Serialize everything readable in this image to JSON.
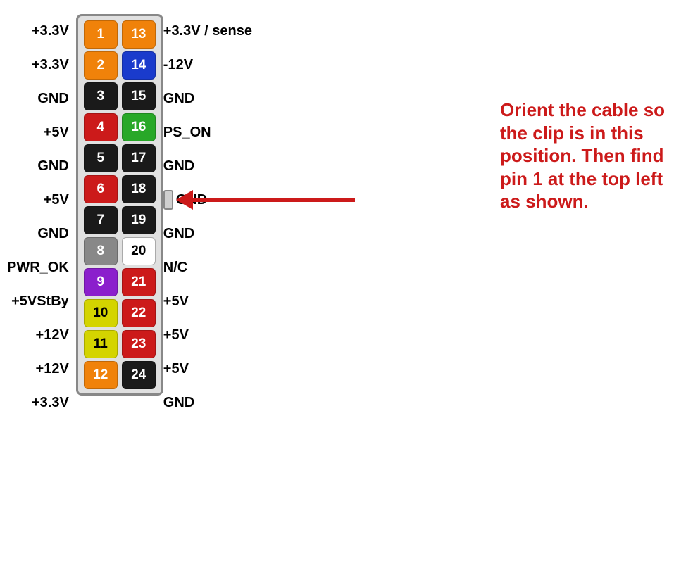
{
  "pins": [
    {
      "left": "+3.3V",
      "num1": "1",
      "color1": "orange",
      "num2": "13",
      "color2": "orange",
      "right": "+3.3V / sense"
    },
    {
      "left": "+3.3V",
      "num1": "2",
      "color1": "orange",
      "num2": "14",
      "color2": "blue",
      "right": "-12V"
    },
    {
      "left": "GND",
      "num1": "3",
      "color1": "black",
      "num2": "15",
      "color2": "black",
      "right": "GND"
    },
    {
      "left": "+5V",
      "num1": "4",
      "color1": "red",
      "num2": "16",
      "color2": "green",
      "right": "PS_ON"
    },
    {
      "left": "GND",
      "num1": "5",
      "color1": "black",
      "num2": "17",
      "color2": "black",
      "right": "GND"
    },
    {
      "left": "+5V",
      "num1": "6",
      "color1": "red",
      "num2": "18",
      "color2": "black",
      "right": "GND",
      "hasClip": true
    },
    {
      "left": "GND",
      "num1": "7",
      "color1": "black",
      "num2": "19",
      "color2": "black",
      "right": "GND"
    },
    {
      "left": "PWR_OK",
      "num1": "8",
      "color1": "gray",
      "num2": "20",
      "color2": "white",
      "right": "N/C"
    },
    {
      "left": "+5VStBy",
      "num1": "9",
      "color1": "purple",
      "num2": "21",
      "color2": "red",
      "right": "+5V"
    },
    {
      "left": "+12V",
      "num1": "10",
      "color1": "yellow",
      "num2": "22",
      "color2": "red",
      "right": "+5V"
    },
    {
      "left": "+12V",
      "num1": "11",
      "color1": "yellow",
      "num2": "23",
      "color2": "red",
      "right": "+5V"
    },
    {
      "left": "+3.3V",
      "num1": "12",
      "color1": "orange",
      "num2": "24",
      "color2": "black",
      "right": "GND"
    }
  ],
  "instruction": "Orient the cable so the clip is in this position. Then find pin 1 at the top left as shown."
}
